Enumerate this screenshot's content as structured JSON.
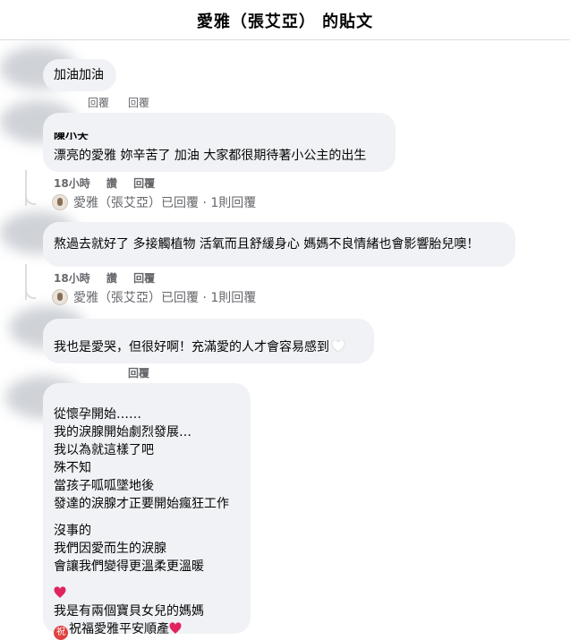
{
  "header": {
    "title": "愛雅（張艾亞） 的貼文"
  },
  "comments": [
    {
      "author": "",
      "text": "加油加油",
      "meta": {
        "like": "",
        "reply": "回覆"
      }
    },
    {
      "author": "陳小天",
      "text": "漂亮的愛雅 妳辛苦了 加油 大家都很期待著小公主的出生",
      "meta": {
        "time": "18小時",
        "like": "讚",
        "reply": "回覆"
      },
      "reply_summary": "愛雅（張艾亞）已回覆 · 1則回覆"
    },
    {
      "author": "",
      "text": "熬過去就好了 多接觸植物 活氧而且舒緩身心 媽媽不良情緒也會影響胎兒噢！",
      "meta": {
        "time": "18小時",
        "like": "讚",
        "reply": "回覆"
      },
      "reply_summary": "愛雅（張艾亞）已回覆 · 1則回覆"
    },
    {
      "author": "",
      "text": "我也是愛哭，但很好啊！充滿愛的人才會容易感到",
      "meta": {
        "reply": "回覆"
      }
    },
    {
      "author": "",
      "paragraphs": [
        [
          "從懷孕開始……",
          "我的淚腺開始劇烈發展…",
          "我以為就這樣了吧",
          "殊不知",
          "當孩子呱呱墜地後",
          "發達的淚腺才正要開始瘋狂工作"
        ],
        [
          "沒事的",
          "我們因愛而生的淚腺",
          "會讓我們變得更溫柔更溫暖"
        ],
        [
          "我是有兩個寶貝女兒的媽媽",
          "祝福愛雅平安順產"
        ]
      ],
      "emoji_pray": "祝"
    }
  ],
  "icons": {
    "heart": "red-heart-icon",
    "white_heart": "white-heart-icon",
    "pray": "congratulations-emoji-icon"
  },
  "colors": {
    "bubble": "#f0f2f5",
    "meta": "#65676b",
    "heart": "#e0245e"
  }
}
